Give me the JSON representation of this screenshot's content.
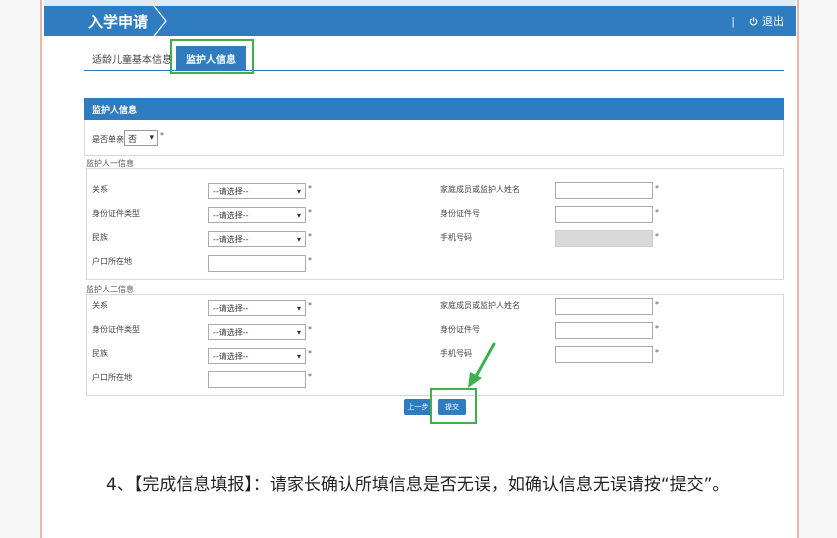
{
  "header": {
    "title": "入学申请",
    "logout_sep": "|",
    "logout_label": "退出"
  },
  "tabs": {
    "basic_info": "适龄儿童基本信息",
    "guardian_info": "监护人信息"
  },
  "panel": {
    "title": "监护人信息",
    "single_parent_label": "是否单亲",
    "single_parent_value": "否"
  },
  "guardian1": {
    "title": "监护人一信息",
    "relation_label": "关系",
    "relation_value": "--请选择--",
    "id_type_label": "身份证件类型",
    "id_type_value": "--请选择--",
    "ethnicity_label": "民族",
    "ethnicity_value": "--请选择--",
    "hukou_label": "户口所在地",
    "name_label": "家庭成员或监护人姓名",
    "id_no_label": "身份证件号",
    "phone_label": "手机号码"
  },
  "guardian2": {
    "title": "监护人二信息",
    "relation_label": "关系",
    "relation_value": "--请选择--",
    "id_type_label": "身份证件类型",
    "id_type_value": "--请选择--",
    "ethnicity_label": "民族",
    "ethnicity_value": "--请选择--",
    "hukou_label": "户口所在地",
    "name_label": "家庭成员或监护人姓名",
    "id_no_label": "身份证件号",
    "phone_label": "手机号码"
  },
  "buttons": {
    "prev": "上一步",
    "submit": "提交"
  },
  "caption": "4、【完成信息填报】：请家长确认所填信息是否无误，如确认信息无误请按“提交”。",
  "colors": {
    "primary": "#2f7cc0",
    "highlight": "#3db04d"
  },
  "icons": {
    "logout": "power-icon",
    "dropdown": "caret-down-icon",
    "arrow": "green-arrow-icon"
  }
}
